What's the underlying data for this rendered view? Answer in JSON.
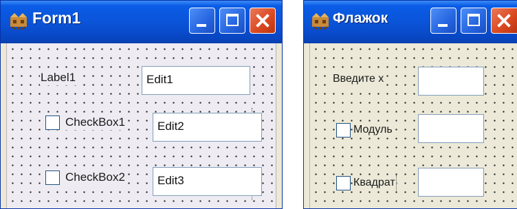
{
  "form1": {
    "title": "Form1",
    "label1": "Label1",
    "edit1": "Edit1",
    "checkbox1": "CheckBox1",
    "edit2": "Edit2",
    "checkbox2": "CheckBox2",
    "edit3": "Edit3"
  },
  "flazhok": {
    "title": "Флажок",
    "label": "Введите х",
    "edit1": "",
    "checkbox1": "Модуль",
    "edit2": "",
    "checkbox2": "Квадрат",
    "edit3": ""
  },
  "colors": {
    "titlebar": "#0a54d9",
    "close_button": "#d9471f",
    "form_background": "#ece9d8"
  },
  "icons": [
    "app-icon",
    "minimize-icon",
    "maximize-icon",
    "close-icon"
  ]
}
